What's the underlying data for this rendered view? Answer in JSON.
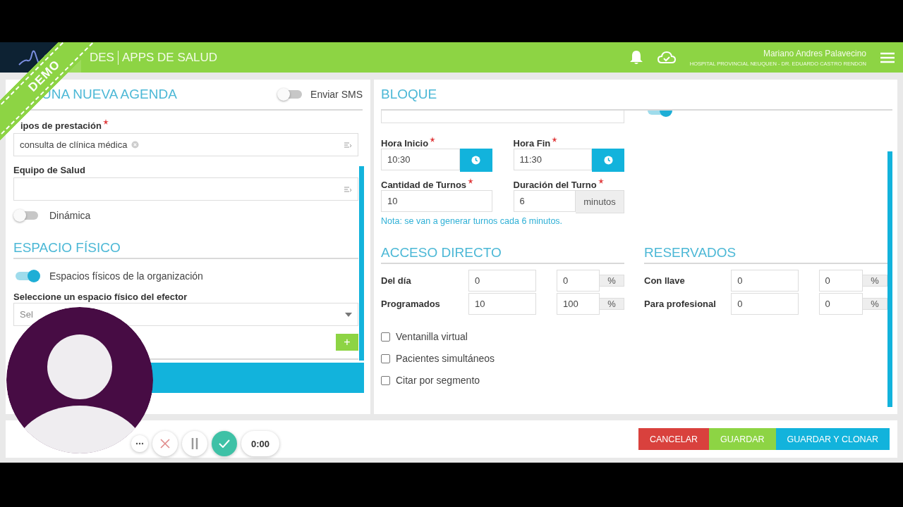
{
  "header": {
    "brand_partial": "DES",
    "app_name": "APPS DE SALUD",
    "user_name": "Mariano Andres Palavecino",
    "organization": "HOSPITAL PROVINCIAL NEUQUEN - DR. EDUARDO CASTRO RENDON"
  },
  "demo_ribbon": "DEMO",
  "agenda": {
    "title": "UNA NUEVA AGENDA",
    "sms_toggle": {
      "label": "Enviar SMS",
      "on": false
    },
    "tipos": {
      "label": "ipos de prestación",
      "required": true,
      "tags": [
        "consulta de clínica médica"
      ]
    },
    "equipo": {
      "label": "Equipo de Salud"
    },
    "dinamica": {
      "label": "Dinámica",
      "on": false
    },
    "espacio_title": "ESPACIO FÍSICO",
    "espacios_toggle": {
      "label": "Espacios físicos de la organización",
      "on": true
    },
    "espacio_select": {
      "label": "Seleccione un espacio físico del efector",
      "placeholder": "Sel"
    },
    "add_button": "+"
  },
  "bloque": {
    "title": "BLOQUE",
    "scrolled_toggle": {
      "on": true
    },
    "hora_inicio": {
      "label": "Hora Inicio",
      "required": true,
      "value": "10:30"
    },
    "hora_fin": {
      "label": "Hora Fin",
      "required": true,
      "value": "11:30"
    },
    "cantidad": {
      "label": "Cantidad de Turnos",
      "required": true,
      "value": "10"
    },
    "duracion": {
      "label": "Duración del Turno",
      "required": true,
      "value": "6",
      "unit": "minutos"
    },
    "note": "Nota: se van a generar turnos cada 6 minutos.",
    "acceso_directo": {
      "title": "ACCESO DIRECTO",
      "rows": [
        {
          "label": "Del día",
          "count": "0",
          "percent": "0",
          "unit": "%"
        },
        {
          "label": "Programados",
          "count": "10",
          "percent": "100",
          "unit": "%"
        }
      ]
    },
    "reservados": {
      "title": "RESERVADOS",
      "rows": [
        {
          "label": "Con llave",
          "count": "0",
          "percent": "0",
          "unit": "%"
        },
        {
          "label": "Para profesional",
          "count": "0",
          "percent": "0",
          "unit": "%"
        }
      ]
    },
    "options": [
      {
        "label": "Ventanilla virtual",
        "checked": false
      },
      {
        "label": "Pacientes simultáneos",
        "checked": false
      },
      {
        "label": "Citar por segmento",
        "checked": false
      }
    ]
  },
  "footer_buttons": [
    {
      "label": "CANCELAR",
      "kind": "danger"
    },
    {
      "label": "GUARDAR",
      "kind": "success"
    },
    {
      "label": "GUARDAR Y CLONAR",
      "kind": "info"
    }
  ],
  "recorder": {
    "time": "0:00"
  }
}
